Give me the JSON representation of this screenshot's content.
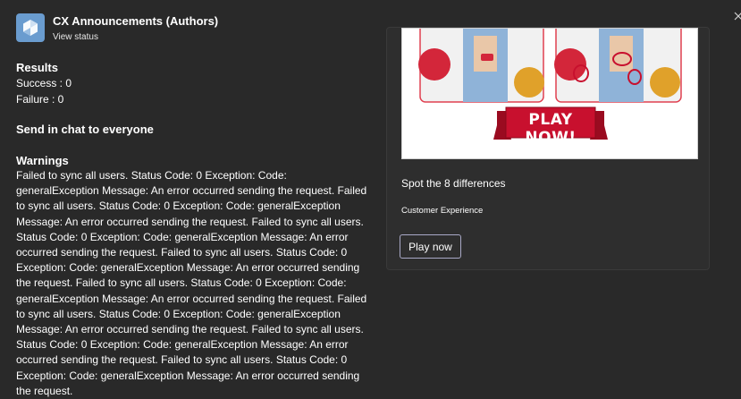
{
  "header": {
    "app_title": "CX Announcements (Authors)",
    "view_status_link": "View status"
  },
  "results": {
    "heading": "Results",
    "success": "Success : 0",
    "failure": "Failure : 0"
  },
  "send": {
    "heading": "Send in chat to everyone"
  },
  "warnings": {
    "heading": "Warnings",
    "text": "Failed to sync all users. Status Code: 0 Exception: Code: generalException Message: An error occurred sending the request. Failed to sync all users. Status Code: 0 Exception: Code: generalException Message: An error occurred sending the request. Failed to sync all users. Status Code: 0 Exception: Code: generalException Message: An error occurred sending the request. Failed to sync all users. Status Code: 0 Exception: Code: generalException Message: An error occurred sending the request. Failed to sync all users. Status Code: 0 Exception: Code: generalException Message: An error occurred sending the request. Failed to sync all users. Status Code: 0 Exception: Code: generalException Message: An error occurred sending the request. Failed to sync all users. Status Code: 0 Exception: Code: generalException Message: An error occurred sending the request. Failed to sync all users. Status Code: 0 Exception: Code: generalException Message: An error occurred sending the request."
  },
  "card": {
    "banner_text": "PLAY NOW!",
    "title": "Spot the 8 differences",
    "subtitle": "Customer Experience",
    "button_label": "Play now"
  },
  "colors": {
    "background": "#292929",
    "card_background": "#2e2e2e",
    "app_icon": "#6a9ccf",
    "banner_red": "#c8102e",
    "button_border": "#a9a9c7"
  }
}
